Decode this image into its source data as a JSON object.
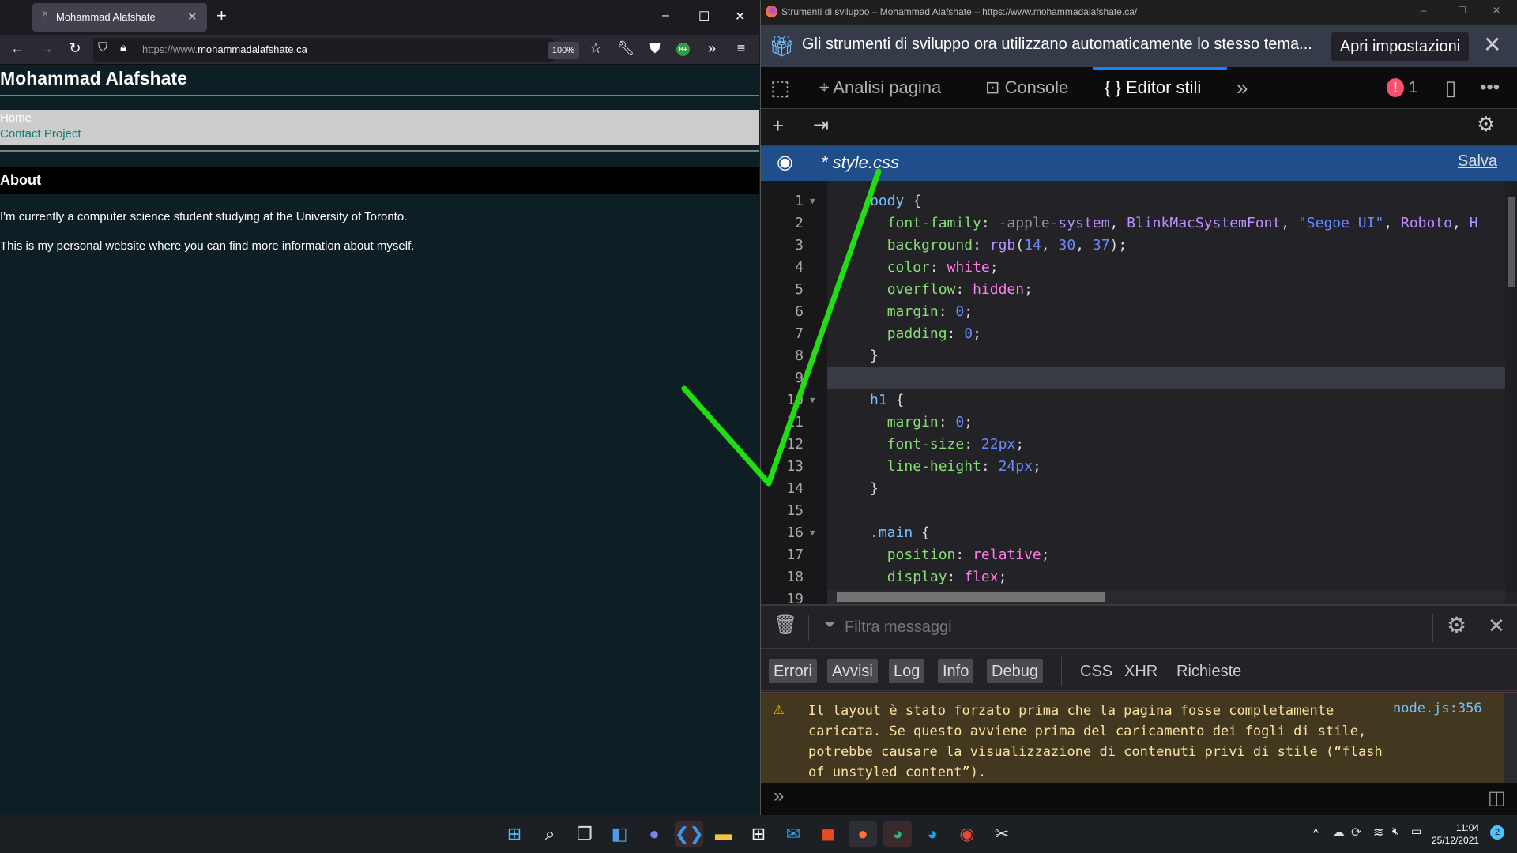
{
  "browser": {
    "tab_title": "Mohammad Alafshate",
    "tab_favicon": "page-favicon",
    "new_tab_label": "+",
    "url_scheme": "https://www.",
    "url_domain": "mohammadalafshate.ca",
    "zoom_level": "100%",
    "window_controls": {
      "minimize": "–",
      "maximize": "☐",
      "close": "✕"
    },
    "extension_badge": "B+"
  },
  "page": {
    "heading": "Mohammad Alafshate",
    "nav": [
      "Home",
      "Contact Project"
    ],
    "section_title": "About",
    "paragraphs": [
      "I'm currently a computer science student studying at the University of Toronto.",
      "This is my personal website where you can find more information about myself."
    ]
  },
  "devtools": {
    "window_title": "Strumenti di sviluppo – Mohammad Alafshate – https://www.mohammadalafshate.ca/",
    "notification": {
      "message": "Gli strumenti di sviluppo ora utilizzano automaticamente lo stesso tema...",
      "button": "Apri impostazioni",
      "close": "✕"
    },
    "tabs": [
      {
        "label": "Analisi pagina",
        "selected": false
      },
      {
        "label": "Console",
        "selected": false
      },
      {
        "label": "Editor stili",
        "selected": true
      }
    ],
    "error_count": "1",
    "accent_color": "#0a84ff",
    "stylesheet": {
      "name": "* style.css",
      "save_label": "Salva"
    },
    "code_lines": [
      {
        "n": "1",
        "fold": true
      },
      {
        "n": "2"
      },
      {
        "n": "3"
      },
      {
        "n": "4"
      },
      {
        "n": "5"
      },
      {
        "n": "6"
      },
      {
        "n": "7"
      },
      {
        "n": "8"
      },
      {
        "n": "9"
      },
      {
        "n": "10",
        "fold": true
      },
      {
        "n": "11"
      },
      {
        "n": "12"
      },
      {
        "n": "13"
      },
      {
        "n": "14"
      },
      {
        "n": "15"
      },
      {
        "n": "16",
        "fold": true
      },
      {
        "n": "17"
      },
      {
        "n": "18"
      },
      {
        "n": "19"
      }
    ],
    "code": {
      "l1_sel": "body",
      "l1_brace": " {",
      "l2_prop": "font-family",
      "l2_a": "-apple-",
      "l2_b": "system",
      "l2_c": "BlinkMacSystemFont",
      "l2_d": "\"Segoe UI\"",
      "l2_e": "Roboto",
      "l2_f": "H",
      "l3_prop": "background",
      "l3_fn": "rgb",
      "l3_r": "14",
      "l3_g": "30",
      "l3_b": "37",
      "l4_prop": "color",
      "l4_val": "white",
      "l5_prop": "overflow",
      "l5_val": "hidden",
      "l6_prop": "margin",
      "l6_val": "0",
      "l7_prop": "padding",
      "l7_val": "0",
      "l8": "}",
      "l10_sel": "h1",
      "l10_brace": " {",
      "l11_prop": "margin",
      "l11_val": "0",
      "l12_prop": "font-size",
      "l12_val": "22px",
      "l13_prop": "line-height",
      "l13_val": "24px",
      "l14": "}",
      "l16_sel": ".main",
      "l16_brace": " {",
      "l17_prop": "position",
      "l17_val": "relative",
      "l18_prop": "display",
      "l18_val": "flex"
    },
    "console": {
      "filter_placeholder": "Filtra messaggi",
      "filter_buttons": [
        "Errori",
        "Avvisi",
        "Log",
        "Info",
        "Debug"
      ],
      "filter_plain": [
        "CSS",
        "XHR",
        "Richieste"
      ],
      "warning_message": "Il layout è stato forzato prima che la pagina fosse completamente caricata. Se questo avviene prima del caricamento dei fogli di stile, potrebbe causare la visualizzazione di contenuti privi di stile (“flash of unstyled content”).",
      "warning_source": "node.js:356",
      "prompt": "»"
    }
  },
  "taskbar": {
    "apps": [
      "start",
      "search",
      "task-view",
      "widgets",
      "teams-chat",
      "vscode",
      "file-explorer",
      "store",
      "mail",
      "office",
      "firefox",
      "edge-profile",
      "edge",
      "screen-recorder",
      "snipping-tool"
    ],
    "time": "11:04",
    "date": "25/12/2021",
    "notification_count": "2"
  },
  "annotation": {
    "type": "checkmark",
    "color": "#22dd11"
  }
}
